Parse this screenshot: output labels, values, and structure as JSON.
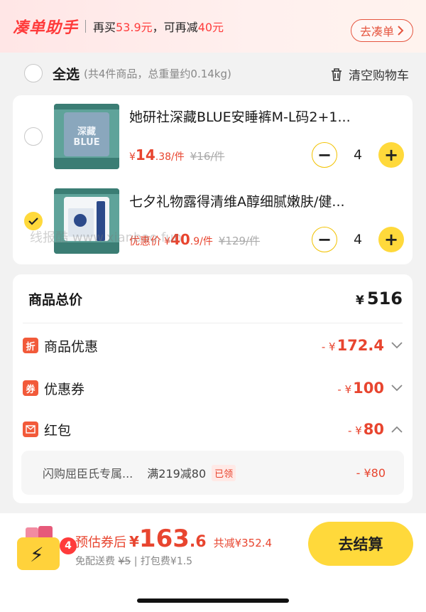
{
  "banner": {
    "logo": "凑单助手",
    "prefix": "再买",
    "buy_more": "53.9元",
    "mid": "，可再减",
    "discount": "40元",
    "button": "去凑单"
  },
  "select_all": {
    "label": "全选",
    "summary": "(共4件商品，总重量约0.14kg)",
    "clear": "清空购物车"
  },
  "items": [
    {
      "title": "她研社深藏BLUE安睡裤M-L码2+1...",
      "thumb_text": "深藏 BLUE",
      "price_yen": "¥",
      "price_int": "14",
      "price_dec": ".38/件",
      "old_price": "¥16/件",
      "qty": "4",
      "selected": false
    },
    {
      "title": "七夕礼物露得清维A醇细腻嫩肤/健...",
      "price_tag": "优惠价",
      "price_yen": "¥",
      "price_int": "40",
      "price_dec": ".9/件",
      "old_price": "¥129/件",
      "qty": "4",
      "selected": true
    }
  ],
  "watermark": "线报酷 www.xianbao.fun",
  "summary": {
    "total_label": "商品总价",
    "total_yen": "¥",
    "total_value": "516",
    "rows": [
      {
        "badge": "折",
        "label": "商品优惠",
        "prefix": "- ¥",
        "amount": "172.4",
        "chevron": "down"
      },
      {
        "badge": "券",
        "label": "优惠券",
        "prefix": "- ¥",
        "amount": "100",
        "chevron": "down"
      },
      {
        "badge": "",
        "label": "红包",
        "prefix": "- ¥",
        "amount": "80",
        "chevron": "up"
      }
    ],
    "red_packet": {
      "name": "闪购屈臣氏专属...",
      "rule": "满219减80",
      "status": "已领",
      "amount": "- ¥80"
    }
  },
  "footer": {
    "cart_count": "4",
    "est_label": "预估券后",
    "est_yen": "¥",
    "est_int": "163",
    "est_dec": ".6",
    "saved": "共减¥352.4",
    "fee_free": "免配送费",
    "fee_struck": "¥5",
    "fee_sep": " | ",
    "pack_fee": "打包费¥1.5",
    "checkout": "去结算"
  },
  "colors": {
    "accent_red": "#e8452f",
    "accent_yellow": "#ffd93b"
  }
}
